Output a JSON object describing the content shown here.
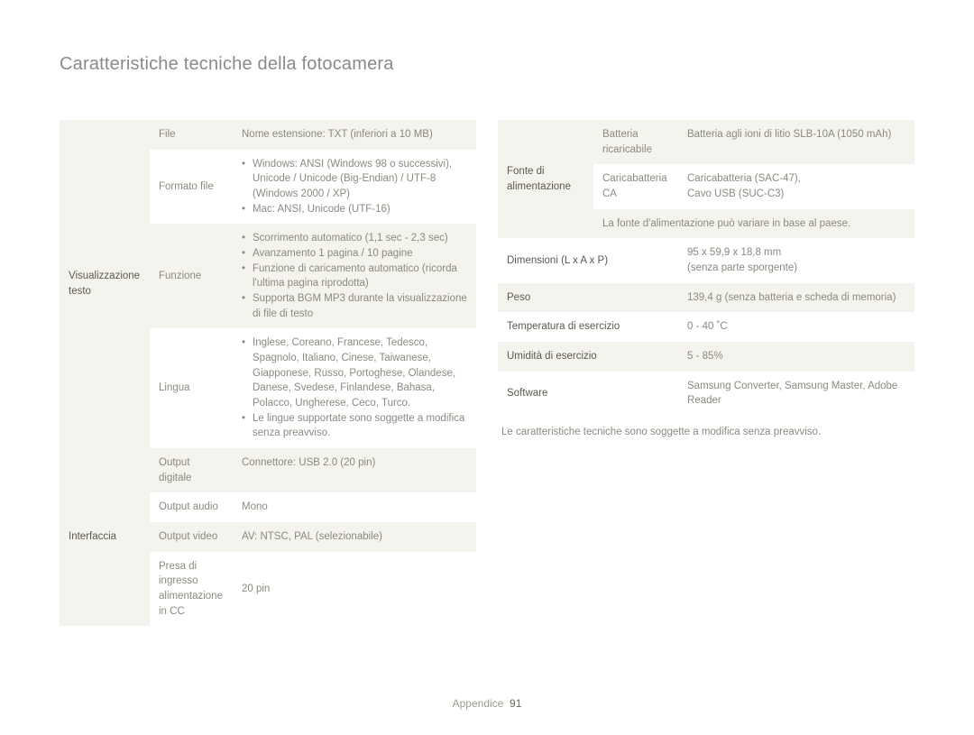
{
  "title": "Caratteristiche tecniche della fotocamera",
  "left": {
    "group1_header": "Visualizzazione testo",
    "rows1": [
      {
        "sub": "File",
        "val": "Nome estensione: TXT (inferiori a 10 MB)"
      }
    ],
    "formatofile_sub": "Formato file",
    "formatofile_items": [
      "Windows: ANSI (Windows 98 o successivi), Unicode / Unicode (Big-Endian) / UTF-8 (Windows 2000 / XP)",
      "Mac: ANSI, Unicode (UTF-16)"
    ],
    "funzione_sub": "Funzione",
    "funzione_items": [
      "Scorrimento automatico (1,1 sec - 2,3 sec)",
      "Avanzamento 1 pagina / 10 pagine",
      "Funzione di caricamento automatico (ricorda l'ultima pagina riprodotta)",
      "Supporta BGM MP3 durante la visualizzazione di file di testo"
    ],
    "lingua_sub": "Lingua",
    "lingua_items": [
      "Inglese, Coreano, Francese, Tedesco, Spagnolo, Italiano, Cinese, Taiwanese, Giapponese, Russo, Portoghese, Olandese, Danese, Svedese, Finlandese, Bahasa, Polacco, Ungherese, Ceco, Turco.",
      "Le lingue supportate sono soggette a modifica senza preavviso."
    ],
    "group2_header": "Interfaccia",
    "rows2": [
      {
        "sub": "Output digitale",
        "val": "Connettore: USB 2.0 (20 pin)"
      },
      {
        "sub": "Output audio",
        "val": "Mono"
      },
      {
        "sub": "Output video",
        "val": "AV: NTSC, PAL (selezionabile)"
      },
      {
        "sub": "Presa di ingresso alimentazione in CC",
        "val": "20 pin"
      }
    ]
  },
  "right": {
    "power_header": "Fonte di alimentazione",
    "power_rows": [
      {
        "sub": "Batteria ricaricabile",
        "val": "Batteria agli ioni di litio SLB-10A (1050 mAh)"
      },
      {
        "sub": "Caricabatteria CA",
        "val": "Caricabatteria (SAC-47),\nCavo USB (SUC-C3)"
      }
    ],
    "power_note": "La fonte d'alimentazione può variare in base al paese.",
    "simple_rows": [
      {
        "hdr": "Dimensioni (L x A x P)",
        "val": "95 x 59,9 x 18,8 mm\n(senza parte sporgente)"
      },
      {
        "hdr": "Peso",
        "val": "139,4 g (senza batteria e scheda di memoria)"
      },
      {
        "hdr": "Temperatura di esercizio",
        "val": "0 - 40 ˚C"
      },
      {
        "hdr": "Umidità di esercizio",
        "val": "5 - 85%"
      },
      {
        "hdr": "Software",
        "val": "Samsung Converter, Samsung Master, Adobe Reader"
      }
    ],
    "disclaimer": "Le caratteristiche tecniche sono soggette a modifica senza preavviso."
  },
  "footer": {
    "section": "Appendice",
    "page": "91"
  }
}
